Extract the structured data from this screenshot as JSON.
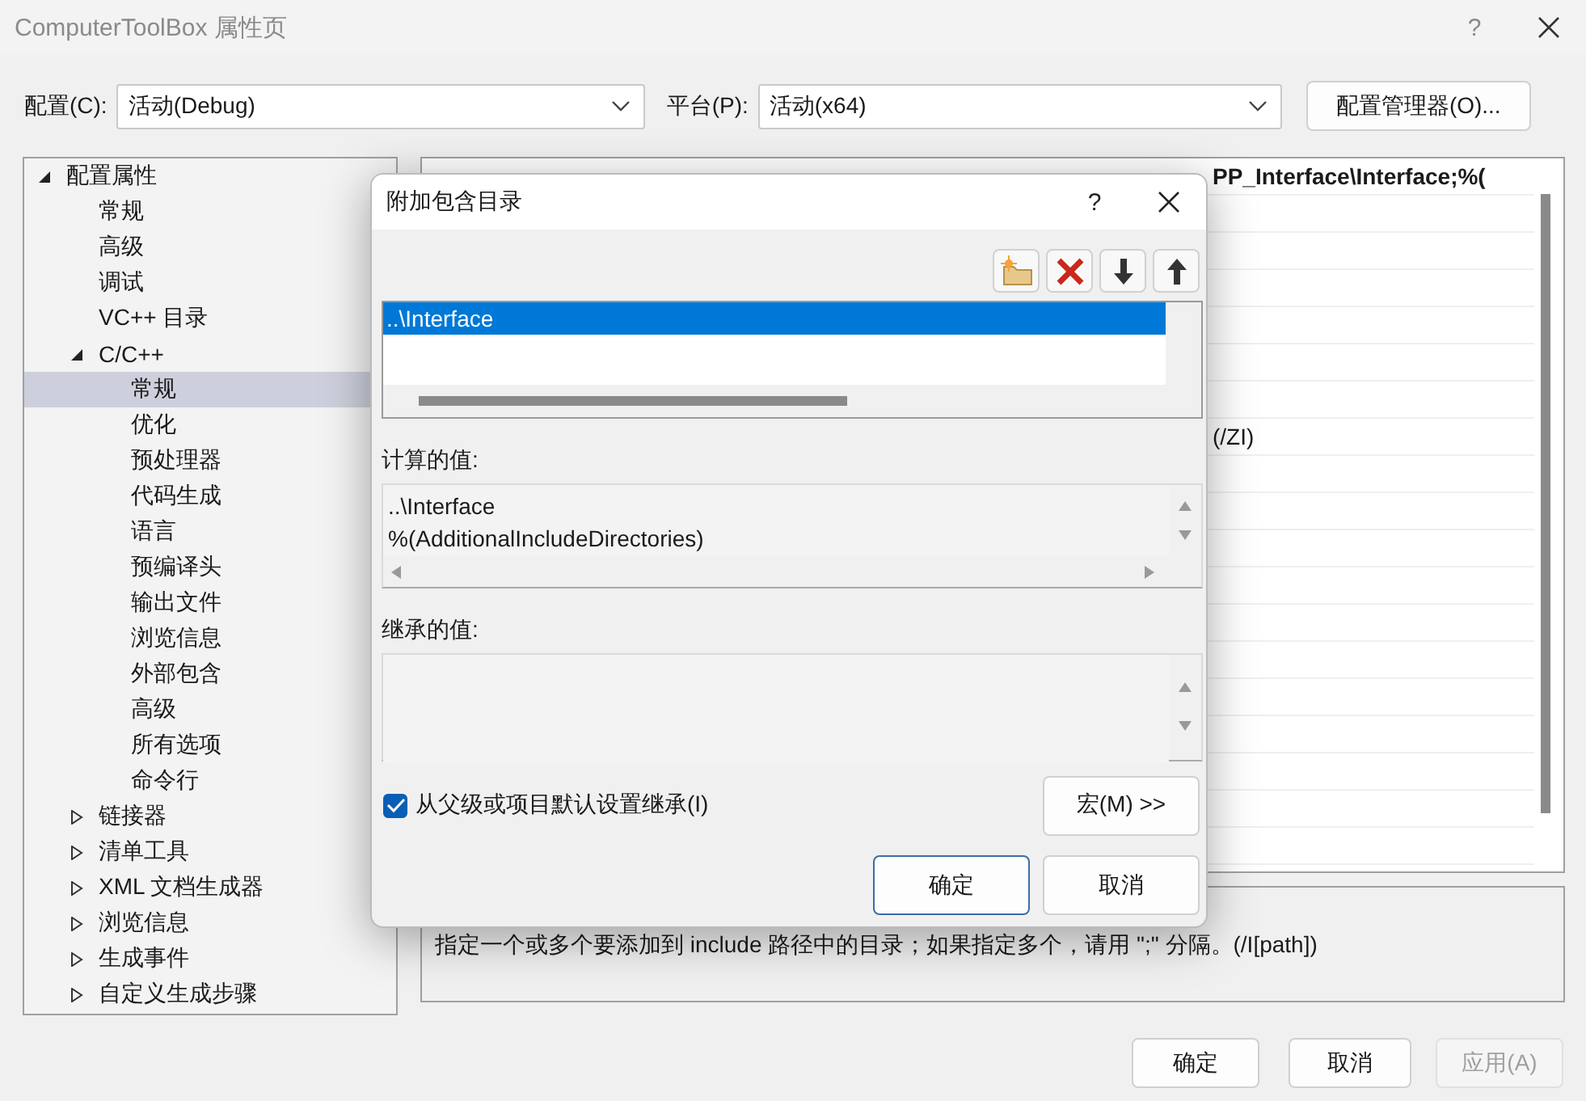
{
  "window": {
    "title": "ComputerToolBox 属性页",
    "help": "?"
  },
  "config_bar": {
    "config_label": "配置(C):",
    "config_value": "活动(Debug)",
    "platform_label": "平台(P):",
    "platform_value": "活动(x64)",
    "manager_button": "配置管理器(O)..."
  },
  "tree": [
    {
      "label": "配置属性",
      "expanded": true,
      "children": [
        {
          "label": "常规",
          "selected": false
        },
        {
          "label": "高级",
          "selected": false
        },
        {
          "label": "调试",
          "selected": false
        },
        {
          "label": "VC++ 目录",
          "selected": false
        },
        {
          "label": "C/C++",
          "expanded": true,
          "selected": false,
          "children": [
            {
              "label": "常规",
              "selected": true
            },
            {
              "label": "优化",
              "selected": false
            },
            {
              "label": "预处理器",
              "selected": false
            },
            {
              "label": "代码生成",
              "selected": false
            },
            {
              "label": "语言",
              "selected": false
            },
            {
              "label": "预编译头",
              "selected": false
            },
            {
              "label": "输出文件",
              "selected": false
            },
            {
              "label": "浏览信息",
              "selected": false
            },
            {
              "label": "外部包含",
              "selected": false
            },
            {
              "label": "高级",
              "selected": false
            },
            {
              "label": "所有选项",
              "selected": false
            },
            {
              "label": "命令行",
              "selected": false
            }
          ]
        },
        {
          "label": "链接器",
          "expanded": false,
          "selected": false
        },
        {
          "label": "清单工具",
          "expanded": false,
          "selected": false
        },
        {
          "label": "XML 文档生成器",
          "expanded": false,
          "selected": false
        },
        {
          "label": "浏览信息",
          "expanded": false,
          "selected": false
        },
        {
          "label": "生成事件",
          "expanded": false,
          "selected": false
        },
        {
          "label": "自定义生成步骤",
          "expanded": false,
          "selected": false
        }
      ]
    }
  ],
  "property_grid": {
    "values": [
      {
        "text": "PP_Interface\\Interface;%(",
        "modified": true
      },
      {
        "text": "(/ZI)",
        "modified": false
      }
    ]
  },
  "description": "指定一个或多个要添加到 include 路径中的目录；如果指定多个，请用 \";\" 分隔。(/I[path])",
  "buttons": [
    {
      "label": "确定",
      "disabled": false
    },
    {
      "label": "取消",
      "disabled": false
    },
    {
      "label": "应用(A)",
      "disabled": true
    }
  ],
  "dialog": {
    "title": "附加包含目录",
    "help": "?",
    "entries": [
      {
        "text": "..\\Interface",
        "selected": true
      }
    ],
    "computed_label": "计算的值:",
    "computed_lines": [
      "..\\Interface",
      "%(AdditionalIncludeDirectories)"
    ],
    "inherited_label": "继承的值:",
    "inherit": {
      "label": "从父级或项目默认设置继承(I)",
      "checked": true
    },
    "macro_button": "宏(M) >>",
    "ok_button": "确定",
    "cancel_button": "取消"
  }
}
